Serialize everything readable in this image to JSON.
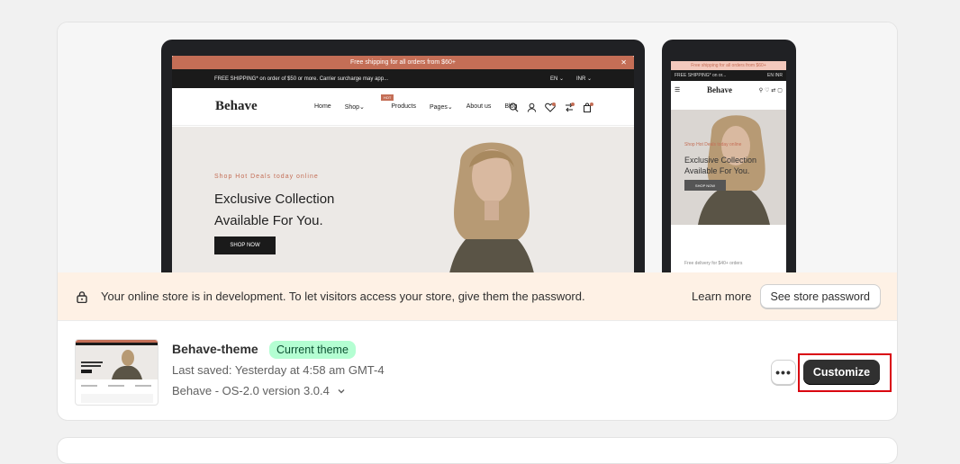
{
  "preview": {
    "desktop": {
      "announcement": "Free shipping for all orders from $60+",
      "topbar_left": "FREE SHIPPING* on order of $50 or more. Carrier surcharge may app...",
      "lang": "EN ⌄",
      "currency": "INR ⌄",
      "logo": "Behave",
      "menu": [
        "Home",
        "Shop",
        "Products",
        "Pages",
        "About us",
        "Blog"
      ],
      "hot_label": "HOT",
      "hero_tag": "Shop Hot Deals today online",
      "hero_title_1": "Exclusive Collection",
      "hero_title_2": "Available For You.",
      "hero_button": "SHOP NOW"
    },
    "mobile": {
      "announcement": "Free shipping for all orders from $60+",
      "topbar": "FREE SHIPPING* on or...",
      "topbar_right": "EN  INR",
      "logo": "Behave",
      "hero_tag": "Shop Hot Deals today online",
      "hero_title_1": "Exclusive Collection",
      "hero_title_2": "Available For You.",
      "hero_button": "SHOP NOW",
      "footer_note": "Free delivery for $40+ orders"
    }
  },
  "banner": {
    "message": "Your online store is in development. To let visitors access your store, give them the password.",
    "learn_more": "Learn more",
    "password_button": "See store password"
  },
  "theme": {
    "name": "Behave-theme",
    "badge": "Current theme",
    "last_saved": "Last saved: Yesterday at 4:58 am GMT-4",
    "version": "Behave - OS-2.0 version 3.0.4",
    "more_label": "•••",
    "customize_label": "Customize"
  },
  "colors": {
    "accent": "#c46e56",
    "badge_bg": "#b4fed2",
    "primary_button": "#303030",
    "highlight": "#d9000f"
  }
}
